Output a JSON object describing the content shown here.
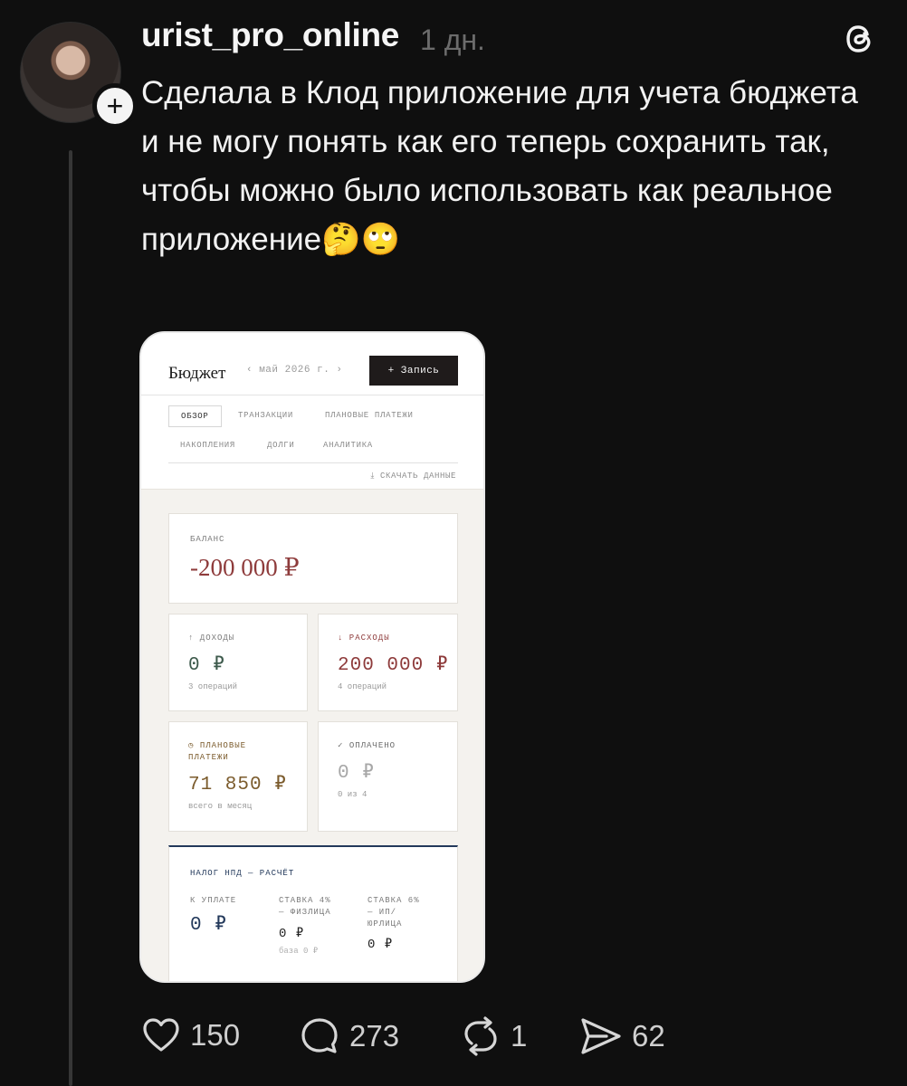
{
  "post": {
    "username": "urist_pro_online",
    "time": "1 дн.",
    "text": "Сделала в Клод приложение для учета бюджета и не могу понять как его теперь сохранить так, чтобы можно было использовать как реальное приложение🤔🙄",
    "follow_label": "+"
  },
  "app": {
    "title": "Бюджет",
    "month_nav": "‹ май 2026 г. ›",
    "add_button": "+ Запись",
    "tabs": [
      "ОБЗОР",
      "ТРАНЗАКЦИИ",
      "ПЛАНОВЫЕ ПЛАТЕЖИ",
      "НАКОПЛЕНИЯ",
      "ДОЛГИ",
      "АНАЛИТИКА"
    ],
    "download": "⤓ СКАЧАТЬ ДАННЫЕ",
    "balance": {
      "label": "БАЛАНС",
      "value": "-200 000 ₽"
    },
    "income": {
      "label": "↑ ДОХОДЫ",
      "value": "0 ₽",
      "sub": "3 операций"
    },
    "expenses": {
      "label": "↓ РАСХОДЫ",
      "value": "200 000 ₽",
      "sub": "4 операций"
    },
    "planned": {
      "label_line1": "◷ ПЛАНОВЫЕ",
      "label_line2": "ПЛАТЕЖИ",
      "value": "71 850 ₽",
      "sub": "всего в месяц"
    },
    "paid": {
      "label": "✓ ОПЛАЧЕНО",
      "value": "0 ₽",
      "sub": "0 из 4"
    },
    "tax": {
      "title": "НАЛОГ НПД — РАСЧЁТ",
      "to_pay_label": "К УПЛАТЕ",
      "to_pay_value": "0 ₽",
      "rate4_label_1": "СТАВКА 4%",
      "rate4_label_2": "— ФИЗЛИЦА",
      "rate4_value": "0 ₽",
      "rate4_sub": "база 0 ₽",
      "rate6_label_1": "СТАВКА 6%",
      "rate6_label_2": "— ИП/",
      "rate6_label_3": "ЮРЛИЦА",
      "rate6_value": "0 ₽"
    },
    "colors": {
      "negative": "#8e3b3b",
      "positive": "#3d5a4c",
      "planned": "#7b5b2c",
      "tax_accent": "#23395b"
    }
  },
  "actions": {
    "likes": "150",
    "comments": "273",
    "reposts": "1",
    "shares": "62"
  }
}
